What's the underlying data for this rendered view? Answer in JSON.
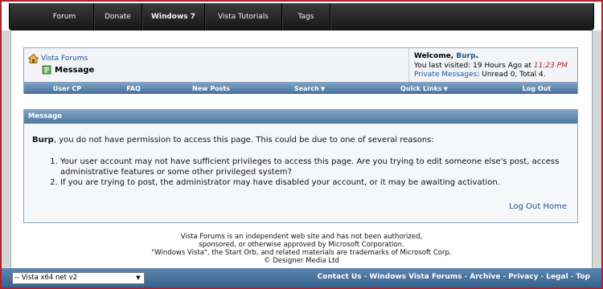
{
  "top_nav": {
    "items": [
      {
        "label": "Forum",
        "active": false
      },
      {
        "label": "Donate",
        "active": false
      },
      {
        "label": "Windows 7",
        "active": true
      },
      {
        "label": "Vista Tutorials",
        "active": false
      },
      {
        "label": "Tags",
        "active": false
      }
    ]
  },
  "breadcrumb": {
    "home_icon": "home-icon",
    "home_label": "Vista Forums",
    "page_icon": "message-icon",
    "page_title": "Message"
  },
  "welcome": {
    "greeting": "Welcome,",
    "username": "Burp",
    "last_visit_prefix": "You last visited: 19 Hours Ago at",
    "last_visit_time": "11:23 PM",
    "pm_label": "Private Messages",
    "pm_counts": ": Unread 0, Total 4."
  },
  "navbar": {
    "user_cp": "User CP",
    "faq": "FAQ",
    "new_posts": "New Posts",
    "search": "Search",
    "quick_links": "Quick Links",
    "log_out": "Log Out"
  },
  "message": {
    "header": "Message",
    "user": "Burp",
    "intro": ", you do not have permission to access this page. This could be due to one of several reasons:",
    "reasons": [
      "Your user account may not have sufficient privileges to access this page. Are you trying to edit someone else's post, access administrative features or some other privileged system?",
      "If you are trying to post, the administrator may have disabled your account, or it may be awaiting activation."
    ],
    "logout_link": "Log Out",
    "home_link": "Home"
  },
  "footer": {
    "line1": "Vista Forums is an independent web site and has not been authorized,",
    "line2": "sponsored, or otherwise approved by Microsoft Corporation.",
    "line3": "\"Windows Vista\", the Start Orb, and related materials are trademarks of Microsoft Corp.",
    "line4": "© Designer Media Ltd"
  },
  "bottom": {
    "style_select_value": "-- Vista x64 net v2",
    "links": [
      "Contact Us",
      "Windows Vista Forums",
      "Archive",
      "Privacy",
      "Legal",
      "Top"
    ]
  },
  "colors": {
    "accent_blue": "#22529b",
    "header_blue": "#46709a",
    "time_red": "#b22222"
  }
}
